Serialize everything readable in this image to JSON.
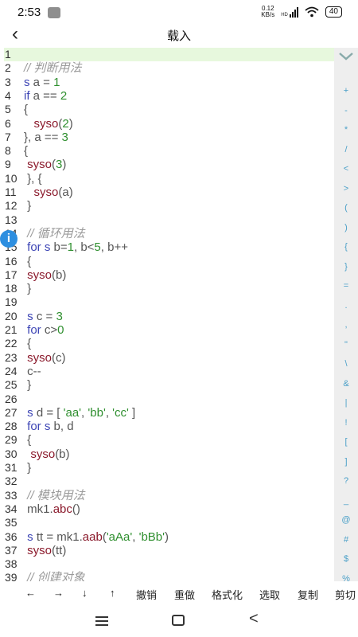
{
  "status": {
    "time": "2:53",
    "speed_top": "0.12",
    "speed_bottom": "KB/s",
    "hd": "HD",
    "battery": "40"
  },
  "header": {
    "title": "载入"
  },
  "code": [
    {
      "n": "1",
      "t": []
    },
    {
      "n": "2",
      "t": [
        [
          "cmt",
          "// 判断用法"
        ]
      ]
    },
    {
      "n": "3",
      "t": [
        [
          "kw",
          "s"
        ],
        [
          "pl",
          " a = "
        ],
        [
          "num",
          "1"
        ]
      ]
    },
    {
      "n": "4",
      "t": [
        [
          "kw",
          "if"
        ],
        [
          "pl",
          " a == "
        ],
        [
          "num",
          "2"
        ]
      ]
    },
    {
      "n": "5",
      "t": [
        [
          "pl",
          "{"
        ]
      ]
    },
    {
      "n": "6",
      "t": [
        [
          "pl",
          "   "
        ],
        [
          "fn",
          "syso"
        ],
        [
          "pl",
          "("
        ],
        [
          "num",
          "2"
        ],
        [
          "pl",
          ")"
        ]
      ]
    },
    {
      "n": "7",
      "t": [
        [
          "pl",
          "}, a == "
        ],
        [
          "num",
          "3"
        ]
      ]
    },
    {
      "n": "8",
      "t": [
        [
          "pl",
          "{"
        ]
      ]
    },
    {
      "n": "9",
      "t": [
        [
          "pl",
          " "
        ],
        [
          "fn",
          "syso"
        ],
        [
          "pl",
          "("
        ],
        [
          "num",
          "3"
        ],
        [
          "pl",
          ")"
        ]
      ]
    },
    {
      "n": "10",
      "t": [
        [
          "pl",
          " }, {"
        ]
      ]
    },
    {
      "n": "11",
      "t": [
        [
          "pl",
          "   "
        ],
        [
          "fn",
          "syso"
        ],
        [
          "pl",
          "(a)"
        ]
      ]
    },
    {
      "n": "12",
      "t": [
        [
          "pl",
          " }"
        ]
      ]
    },
    {
      "n": "13",
      "t": []
    },
    {
      "n": "14",
      "t": [
        [
          "cmt",
          " // 循环用法"
        ]
      ]
    },
    {
      "n": "15",
      "t": [
        [
          "pl",
          " "
        ],
        [
          "kw",
          "for s"
        ],
        [
          "pl",
          " b="
        ],
        [
          "num",
          "1"
        ],
        [
          "pl",
          ", b<"
        ],
        [
          "num",
          "5"
        ],
        [
          "pl",
          ", b++"
        ]
      ]
    },
    {
      "n": "16",
      "t": [
        [
          "pl",
          " {"
        ]
      ]
    },
    {
      "n": "17",
      "t": [
        [
          "pl",
          " "
        ],
        [
          "fn",
          "syso"
        ],
        [
          "pl",
          "(b)"
        ]
      ]
    },
    {
      "n": "18",
      "t": [
        [
          "pl",
          " }"
        ]
      ]
    },
    {
      "n": "19",
      "t": []
    },
    {
      "n": "20",
      "t": [
        [
          "pl",
          " "
        ],
        [
          "kw",
          "s"
        ],
        [
          "pl",
          " c = "
        ],
        [
          "num",
          "3"
        ]
      ]
    },
    {
      "n": "21",
      "t": [
        [
          "pl",
          " "
        ],
        [
          "kw",
          "for"
        ],
        [
          "pl",
          " c>"
        ],
        [
          "num",
          "0"
        ]
      ]
    },
    {
      "n": "22",
      "t": [
        [
          "pl",
          " {"
        ]
      ]
    },
    {
      "n": "23",
      "t": [
        [
          "pl",
          " "
        ],
        [
          "fn",
          "syso"
        ],
        [
          "pl",
          "(c)"
        ]
      ]
    },
    {
      "n": "24",
      "t": [
        [
          "pl",
          " c--"
        ]
      ]
    },
    {
      "n": "25",
      "t": [
        [
          "pl",
          " }"
        ]
      ]
    },
    {
      "n": "26",
      "t": []
    },
    {
      "n": "27",
      "t": [
        [
          "pl",
          " "
        ],
        [
          "kw",
          "s"
        ],
        [
          "pl",
          " d = [ "
        ],
        [
          "str",
          "'aa'"
        ],
        [
          "pl",
          ", "
        ],
        [
          "str",
          "'bb'"
        ],
        [
          "pl",
          ", "
        ],
        [
          "str",
          "'cc'"
        ],
        [
          "pl",
          " ]"
        ]
      ]
    },
    {
      "n": "28",
      "t": [
        [
          "pl",
          " "
        ],
        [
          "kw",
          "for s"
        ],
        [
          "pl",
          " b, d"
        ]
      ]
    },
    {
      "n": "29",
      "t": [
        [
          "pl",
          " {"
        ]
      ]
    },
    {
      "n": "30",
      "t": [
        [
          "pl",
          "  "
        ],
        [
          "fn",
          "syso"
        ],
        [
          "pl",
          "(b)"
        ]
      ]
    },
    {
      "n": "31",
      "t": [
        [
          "pl",
          " }"
        ]
      ]
    },
    {
      "n": "32",
      "t": []
    },
    {
      "n": "33",
      "t": [
        [
          "cmt",
          " // 模块用法"
        ]
      ]
    },
    {
      "n": "34",
      "t": [
        [
          "pl",
          " mk1."
        ],
        [
          "fn",
          "abc"
        ],
        [
          "pl",
          "()"
        ]
      ]
    },
    {
      "n": "35",
      "t": []
    },
    {
      "n": "36",
      "t": [
        [
          "pl",
          " "
        ],
        [
          "kw",
          "s"
        ],
        [
          "pl",
          " tt = mk1."
        ],
        [
          "fn",
          "aab"
        ],
        [
          "pl",
          "("
        ],
        [
          "str",
          "'aAa'"
        ],
        [
          "pl",
          ", "
        ],
        [
          "str",
          "'bBb'"
        ],
        [
          "pl",
          ")"
        ]
      ]
    },
    {
      "n": "37",
      "t": [
        [
          "pl",
          " "
        ],
        [
          "fn",
          "syso"
        ],
        [
          "pl",
          "(tt)"
        ]
      ]
    },
    {
      "n": "38",
      "t": []
    },
    {
      "n": "39",
      "t": [
        [
          "cmt",
          " // 创建对象"
        ]
      ]
    }
  ],
  "side_symbols": [
    "+",
    "-",
    "*",
    "/",
    "<",
    ">",
    "(",
    ")",
    "{",
    "}",
    "=",
    ".",
    ",",
    "\"",
    "\\",
    "&",
    "|",
    "!",
    "[",
    "]",
    "?",
    "_",
    "@",
    "#",
    "$",
    "%"
  ],
  "toolbar": {
    "left": "←",
    "right": "→",
    "down": "↓",
    "up": "↑",
    "undo": "撤销",
    "redo": "重做",
    "format": "格式化",
    "select": "选取",
    "copy": "复制",
    "cut": "剪切"
  },
  "navbar": {
    "back": "<"
  }
}
